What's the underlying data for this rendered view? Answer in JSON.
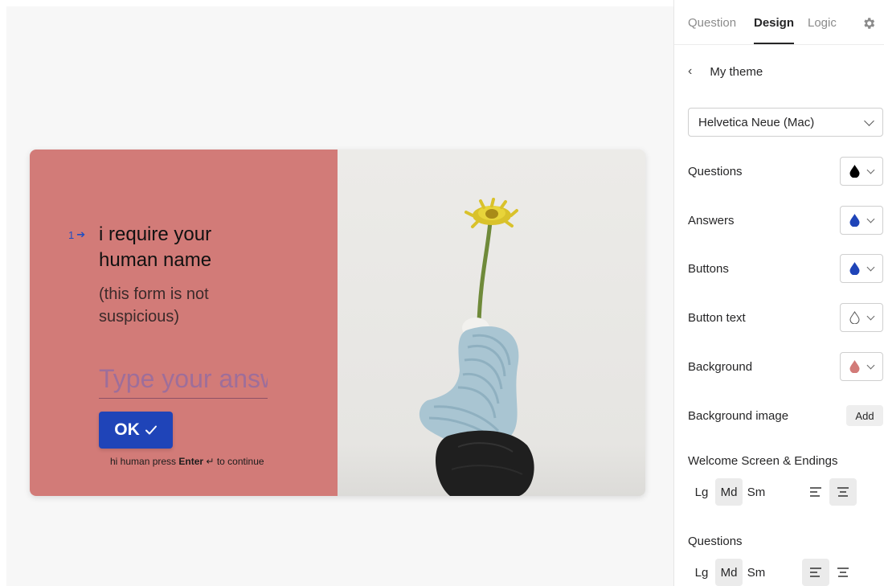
{
  "form": {
    "question_number": "1",
    "question_title": "i require your human name",
    "question_description": "(this form is not suspicious)",
    "answer_placeholder": "Type your answer here...",
    "ok_label": "OK",
    "hint_prefix": "hi human press",
    "hint_key": "Enter",
    "hint_suffix": "to continue"
  },
  "panel": {
    "tabs": [
      "Question",
      "Design",
      "Logic"
    ],
    "active_tab": "Design",
    "theme_name": "My theme",
    "font": "Helvetica Neue (Mac)",
    "colors": [
      {
        "label": "Questions",
        "color": "#000000",
        "filled": true
      },
      {
        "label": "Answers",
        "color": "#1f44b8",
        "filled": true
      },
      {
        "label": "Buttons",
        "color": "#1f44b8",
        "filled": true
      },
      {
        "label": "Button text",
        "color": "#ffffff",
        "filled": false
      },
      {
        "label": "Background",
        "color": "#d27b78",
        "filled": true
      }
    ],
    "background_image_label": "Background image",
    "add_label": "Add",
    "welcome_label": "Welcome Screen & Endings",
    "questions_label": "Questions",
    "sizes": [
      "Lg",
      "Md",
      "Sm"
    ],
    "welcome_size": "Md",
    "welcome_align": "center",
    "questions_size": "Md",
    "questions_align": "left"
  },
  "accent": "#1f44b8",
  "background_color": "#d27b78"
}
